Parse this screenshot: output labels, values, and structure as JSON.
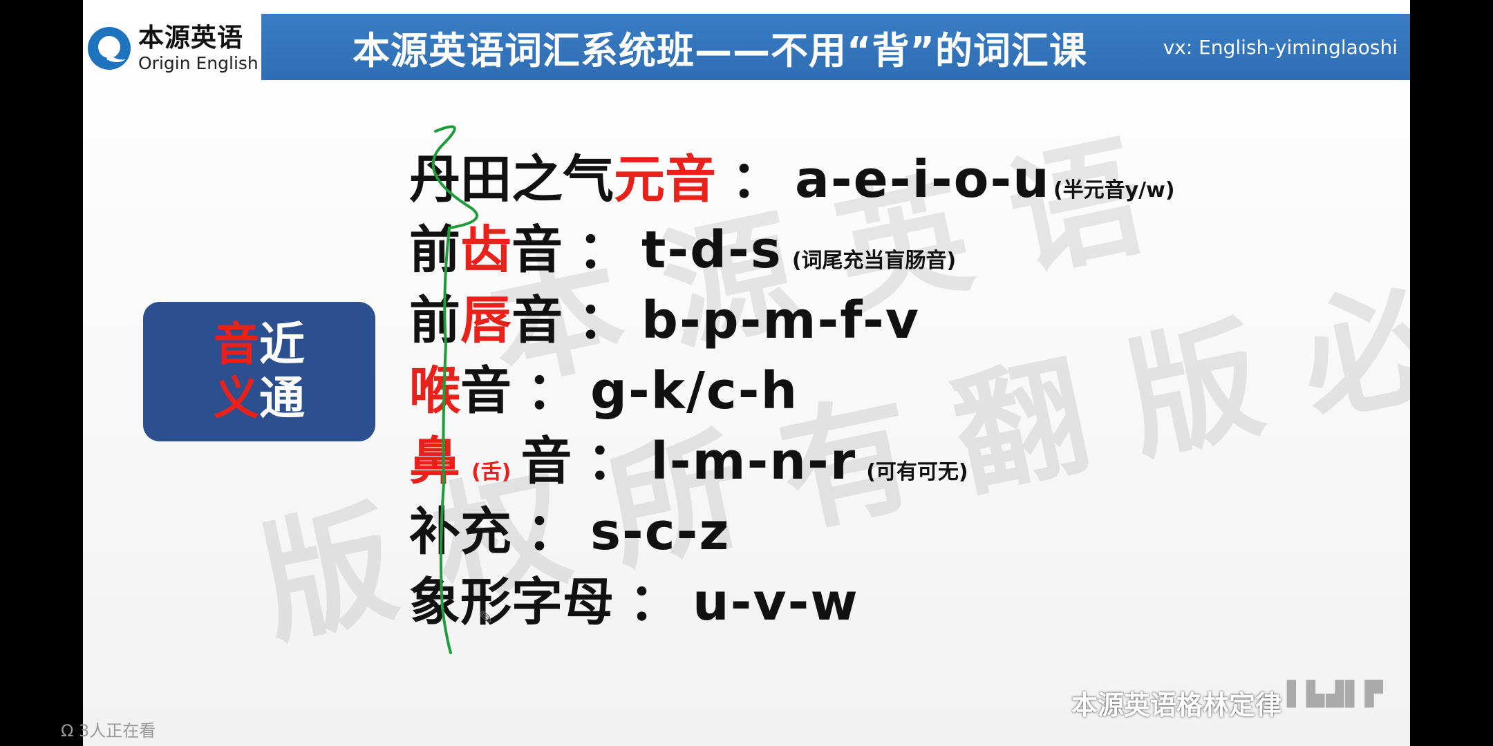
{
  "logo": {
    "cn": "本源英语",
    "en": "Origin English",
    "icon": "origin-q-logo-icon"
  },
  "header": {
    "title": "本源英语词汇系统班——不用“背”的词汇课",
    "contact": "vx: English-yiminglaoshi"
  },
  "watermark": {
    "line1": "本 源 英 语",
    "line2": "版 权 所 有   翻 版 必 究"
  },
  "concept_box": {
    "c1": "音",
    "c2": "近",
    "c3": "义",
    "c4": "通"
  },
  "rules": [
    {
      "parts": [
        "丹田之气",
        "元音"
      ],
      "letters": "a-e-i-o-u",
      "note": "(半元音y/w)"
    },
    {
      "parts": [
        "前",
        "齿",
        "音"
      ],
      "letters": "t-d-s",
      "note": "(词尾充当盲肠音)"
    },
    {
      "parts": [
        "前",
        "唇",
        "音"
      ],
      "letters": "b-p-m-f-v",
      "note": ""
    },
    {
      "parts": [
        "喉",
        "音"
      ],
      "letters": "g-k/c-h",
      "note": ""
    },
    {
      "parts": [
        "鼻",
        "(舌)",
        "音"
      ],
      "letters": "l-m-n-r",
      "note": "(可有可无)"
    },
    {
      "parts": [
        "补充"
      ],
      "letters": "s-c-z",
      "note": ""
    },
    {
      "parts": [
        "象形字母"
      ],
      "letters": "u-v-w",
      "note": ""
    }
  ],
  "colon": "：",
  "footer": {
    "brand": "本源英语格林定律",
    "marks": "▌▙▟▌▛"
  },
  "overlay": {
    "viewers": "Ω 3人正在看",
    "icon": "viewers-icon"
  },
  "colors": {
    "accent_red": "#e8211b",
    "header_blue": "#2d6db3",
    "box_navy": "#2c4f8f",
    "pen_green": "#1f9c3a"
  }
}
